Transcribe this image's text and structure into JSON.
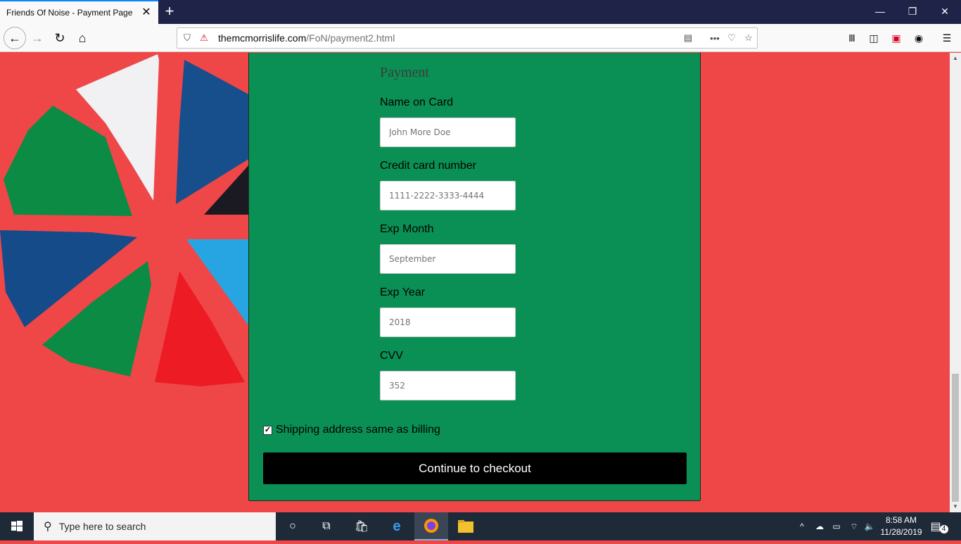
{
  "browser": {
    "tab_title": "Friends Of Noise - Payment Page",
    "url_domain": "themcmorrislife.com",
    "url_path": "/FoN/payment2.html"
  },
  "form": {
    "heading": "Payment",
    "fields": [
      {
        "label": "Name on Card",
        "placeholder": "John More Doe"
      },
      {
        "label": "Credit card number",
        "placeholder": "1111-2222-3333-4444"
      },
      {
        "label": "Exp Month",
        "placeholder": "September"
      },
      {
        "label": "Exp Year",
        "placeholder": "2018"
      },
      {
        "label": "CVV",
        "placeholder": "352"
      }
    ],
    "checkbox_label": "Shipping address same as billing",
    "checkbox_checked": true,
    "submit_label": "Continue to checkout"
  },
  "taskbar": {
    "search_placeholder": "Type here to search",
    "time": "8:58 AM",
    "date": "11/28/2019",
    "notification_count": "4"
  },
  "colors": {
    "page_bg": "#ef4748",
    "panel_bg": "#0a9054",
    "button_bg": "#000000"
  }
}
